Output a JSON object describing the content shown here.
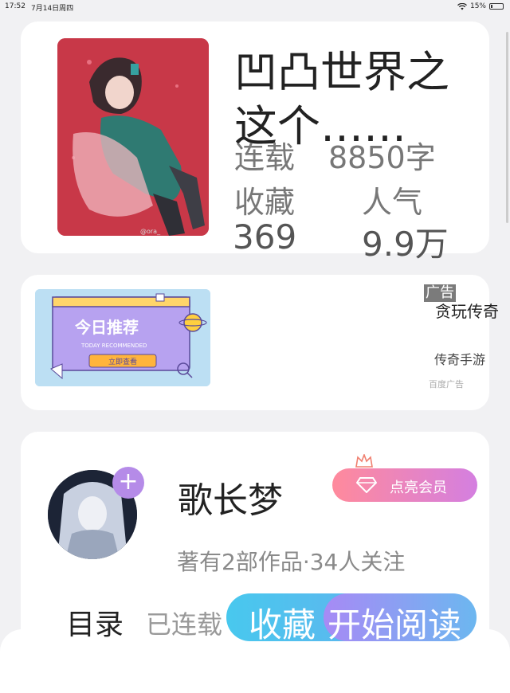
{
  "status_bar": {
    "time": "17:52",
    "date": "7月14日周四",
    "battery": "15%",
    "battery_level": 0.15
  },
  "book": {
    "title": "凹凸世界之这个……",
    "serial_label": "连载",
    "word_count": "8850字",
    "favorites_label": "收藏",
    "favorites_value": "369",
    "popularity_label": "人气",
    "popularity_value": "9.9万",
    "cover_watermark": "@ora_"
  },
  "ad": {
    "banner_title": "今日推荐",
    "banner_subtitle": "TODAY RECOMMENDED",
    "banner_button": "立即查看",
    "tag": "广告",
    "headline": "贪玩传奇",
    "subtitle": "传奇手游",
    "source": "百度广告"
  },
  "author": {
    "name": "歌长梦",
    "follow_icon": "plus-icon",
    "vip_button": "点亮会员",
    "meta": "著有2部作品·34人关注"
  },
  "bottom_bar": {
    "toc": "目录",
    "serial_status": "已连载",
    "favorite": "收藏",
    "start_reading": "开始阅读"
  },
  "colors": {
    "accent_blue": "#48c8ee",
    "accent_purple": "#b58be8",
    "vip_pink": "#ff8a9c",
    "cover_red": "#cc3a4a"
  }
}
